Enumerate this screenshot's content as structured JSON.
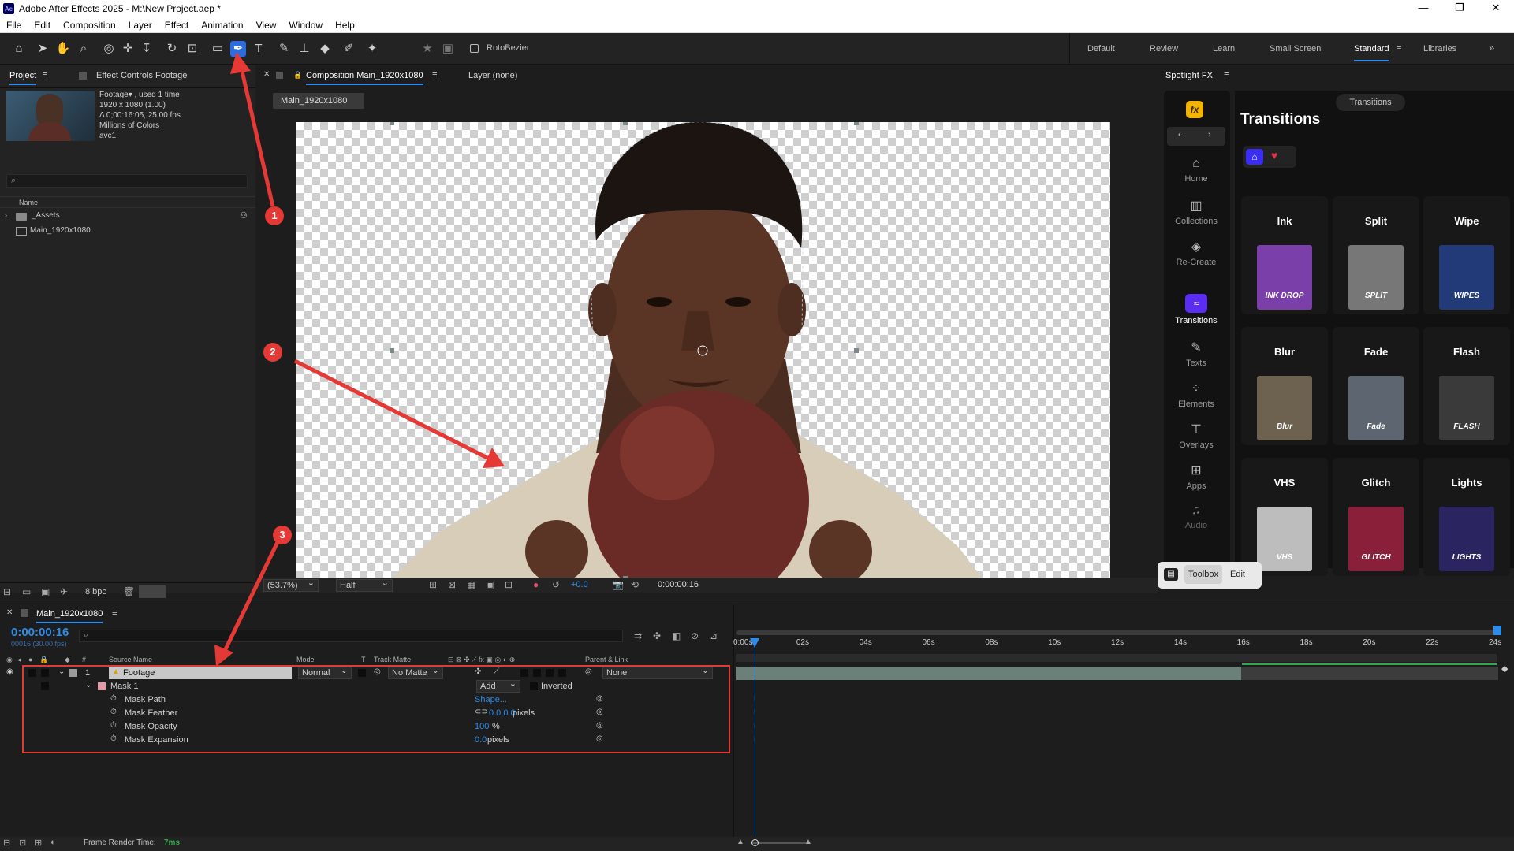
{
  "window": {
    "app_badge": "Ae",
    "title": "Adobe After Effects 2025 - M:\\New Project.aep *",
    "controls": [
      "—",
      "❐",
      "✕"
    ]
  },
  "menu": [
    "File",
    "Edit",
    "Composition",
    "Layer",
    "Effect",
    "Animation",
    "View",
    "Window",
    "Help"
  ],
  "toolbar": {
    "rotobezier_label": "RotoBezier",
    "workspaces": [
      "Default",
      "Review",
      "Learn",
      "Small Screen",
      "Standard",
      "Libraries"
    ],
    "active_workspace": "Standard"
  },
  "project": {
    "tab": "Project",
    "effect_controls_tab": "Effect Controls Footage",
    "footage_name": "Footage▾ , used 1 time",
    "footage_info": [
      "1920 x 1080 (1.00)",
      "Δ 0;00:16:05, 25.00 fps",
      "Millions of Colors",
      "avc1"
    ],
    "name_column": "Name",
    "items": [
      "_Assets",
      "Main_1920x1080"
    ],
    "bpc": "8 bpc"
  },
  "composition": {
    "tab": "Composition Main_1920x1080",
    "layer_tab": "Layer (none)",
    "sub_tab": "Main_1920x1080",
    "zoom": "(53.7%)",
    "resolution": "Half",
    "exposure": "+0.0",
    "timecode": "0:00:00:16"
  },
  "timeline": {
    "tab": "Main_1920x1080",
    "current_time": "0:00:00:16",
    "frame_info": "00016 (30.00 fps)",
    "columns": {
      "source": "Source Name",
      "mode": "Mode",
      "t": "T",
      "track_matte": "Track Matte",
      "parent": "Parent & Link",
      "num": "#"
    },
    "layer": {
      "index": "1",
      "name": "Footage",
      "mode": "Normal",
      "matte": "No Matte",
      "parent": "None"
    },
    "mask": {
      "name": "Mask 1",
      "mode": "Add",
      "inverted": "Inverted"
    },
    "properties": [
      {
        "name": "Mask Path",
        "value": "Shape...",
        "unit": ""
      },
      {
        "name": "Mask Feather",
        "value": "0.0,0.0",
        "unit": " pixels"
      },
      {
        "name": "Mask Opacity",
        "value": "100",
        "unit": "%"
      },
      {
        "name": "Mask Expansion",
        "value": "0.0",
        "unit": " pixels"
      }
    ],
    "ruler": [
      "0:00s",
      "02s",
      "04s",
      "06s",
      "08s",
      "10s",
      "12s",
      "14s",
      "16s",
      "18s",
      "20s",
      "22s",
      "24s"
    ],
    "render_time_label": "Frame Render Time:",
    "render_time_value": "7ms"
  },
  "spotlight": {
    "tab": "Spotlight FX",
    "fx_badge": "fx",
    "heading": "Transitions",
    "pill": "Transitions",
    "nav": [
      {
        "label": "Home",
        "icon": "home-icon"
      },
      {
        "label": "Collections",
        "icon": "collections-icon"
      },
      {
        "label": "Re-Create",
        "icon": "recreate-icon"
      },
      {
        "label": "Transitions",
        "icon": "transitions-icon"
      },
      {
        "label": "Texts",
        "icon": "texts-icon"
      },
      {
        "label": "Elements",
        "icon": "elements-icon"
      },
      {
        "label": "Overlays",
        "icon": "overlays-icon"
      },
      {
        "label": "Apps",
        "icon": "apps-icon"
      },
      {
        "label": "Audio",
        "icon": "audio-icon"
      }
    ],
    "cards": [
      {
        "title": "Ink",
        "thumb": "INK DROP",
        "color": "#7a3fa8"
      },
      {
        "title": "Split",
        "thumb": "SPLIT",
        "color": "#777777"
      },
      {
        "title": "Wipe",
        "thumb": "WIPES",
        "color": "#223a78"
      },
      {
        "title": "Blur",
        "thumb": "Blur",
        "color": "#6d6150"
      },
      {
        "title": "Fade",
        "thumb": "Fade",
        "color": "#5d6570"
      },
      {
        "title": "Flash",
        "thumb": "FLASH",
        "color": "#3a3a3a"
      },
      {
        "title": "VHS",
        "thumb": "VHS",
        "color": "#bdbdbd"
      },
      {
        "title": "Glitch",
        "thumb": "GLITCH",
        "color": "#8a1f3a"
      },
      {
        "title": "Lights",
        "thumb": "LIGHTS",
        "color": "#2a2460"
      }
    ],
    "toolbox_label": "Toolbox",
    "edit_label": "Edit"
  },
  "annotations": [
    "1",
    "2",
    "3"
  ],
  "colors": {
    "accent_blue": "#2d6cdf",
    "annotation_red": "#e53935",
    "timecode_blue": "#2d8ceb"
  }
}
